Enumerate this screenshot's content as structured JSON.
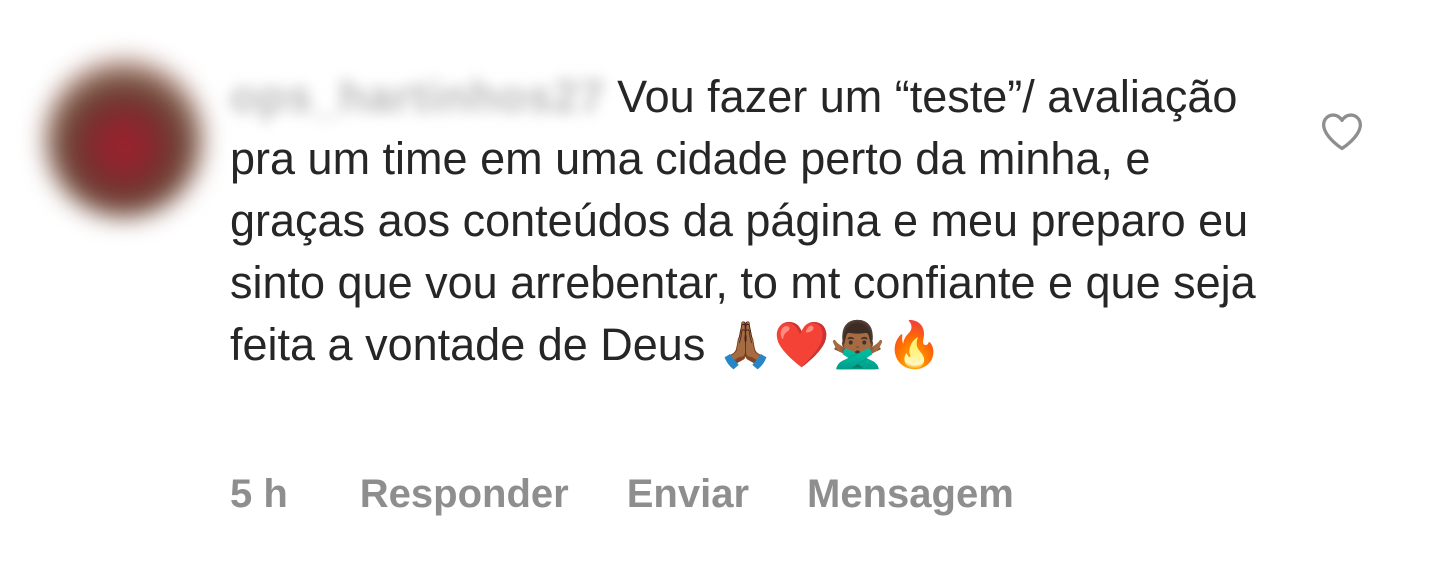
{
  "comment": {
    "username": "ops_hartinhos27",
    "text": "Vou fazer um “teste”/ avaliação pra um time em uma cidade perto da minha, e graças aos conteúdos da página e meu preparo eu sinto que vou arrebentar, to mt confiante e que seja feita a vontade de Deus",
    "emojis": "🙏🏾❤️🙅🏾‍♂️🔥",
    "time": "5 h",
    "actions": {
      "reply": "Responder",
      "send": "Enviar",
      "message": "Mensagem"
    },
    "like_icon": "heart-outline-icon",
    "colors": {
      "text": "#262626",
      "secondary": "#8e8e8e"
    }
  }
}
